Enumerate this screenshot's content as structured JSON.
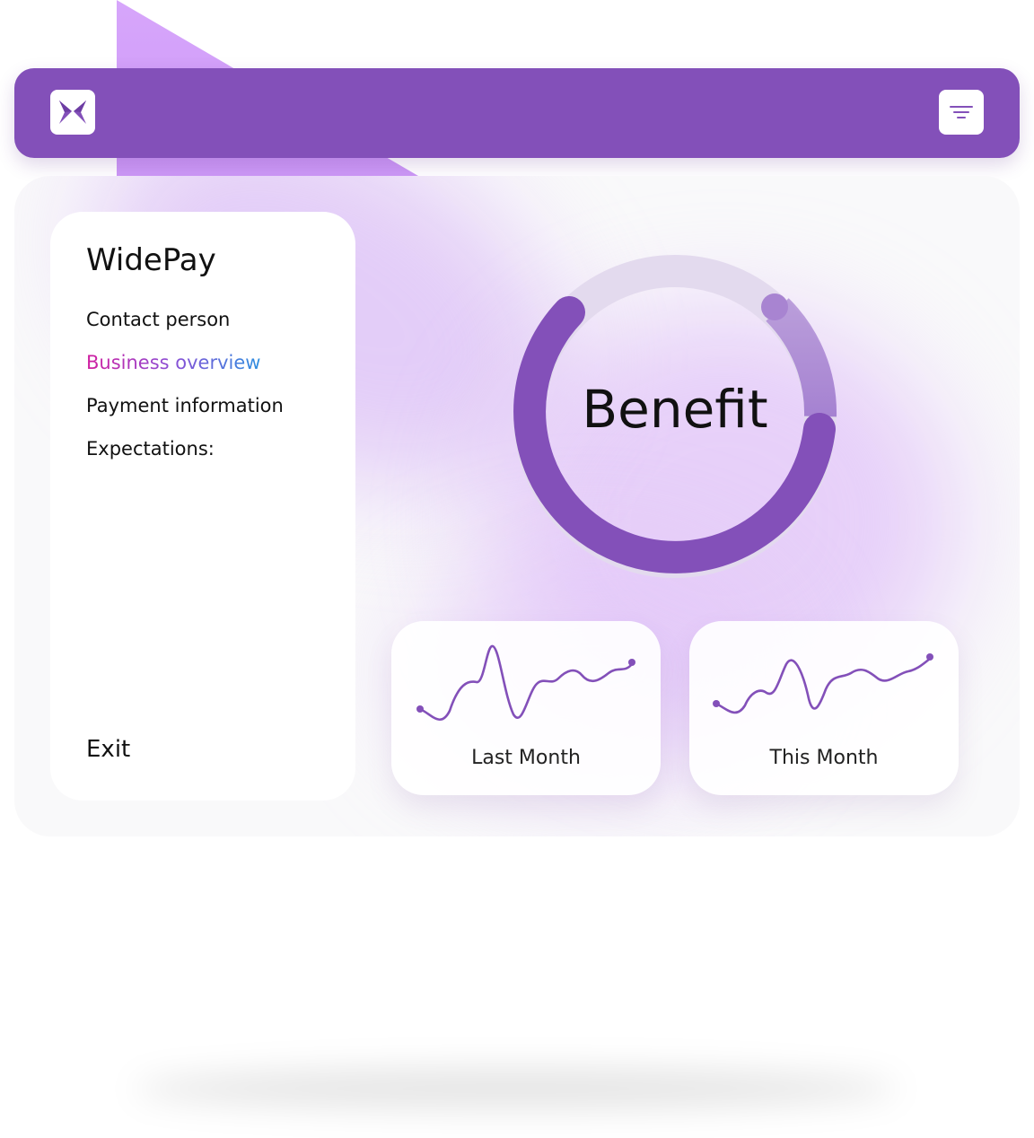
{
  "app": {
    "brand": "WidePay",
    "accent_color": "#8350b9",
    "logo_icon": "butterfly-logo-icon",
    "menu_icon": "filter-menu-icon"
  },
  "sidebar": {
    "items": [
      {
        "label": "Contact person",
        "active": false
      },
      {
        "label": "Business overview",
        "active": true
      },
      {
        "label": "Payment information",
        "active": false
      },
      {
        "label": "Expectations:",
        "active": false
      }
    ],
    "exit_label": "Exit"
  },
  "gauge": {
    "label": "Benefit",
    "track_color": "#e3daee",
    "fill_color": "#8350b9"
  },
  "cards": [
    {
      "label": "Last Month",
      "icon": "sparkline-icon"
    },
    {
      "label": "This Month",
      "icon": "sparkline-icon"
    }
  ]
}
